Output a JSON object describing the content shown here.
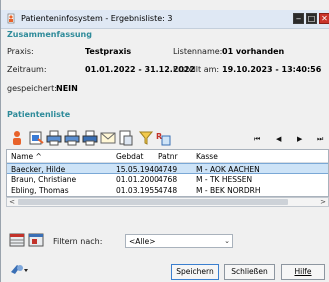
{
  "window": {
    "title": "Patienteninfosystem - Ergebnisliste: 3",
    "minimize": "‒",
    "maximize": "□",
    "close": "✕"
  },
  "summary": {
    "heading": "Zusammenfassung",
    "praxis_label": "Praxis:",
    "praxis_value": "Testpraxis",
    "listname_label": "Listenname:",
    "listname_value": "01 vorhanden",
    "zeitraum_label": "Zeitraum:",
    "zeitraum_value": "01.01.2022 - 31.12.2022",
    "erstellt_label": "Erstellt am:",
    "erstellt_value": "19.10.2023 - 13:40:56",
    "gespeichert_label": "gespeichert:",
    "gespeichert_value": "NEIN"
  },
  "patients": {
    "heading": "Patientenliste",
    "nav": {
      "first": "⏮",
      "prev": "◀",
      "next": "▶",
      "last": "⏭"
    },
    "columns": [
      "Name ^",
      "Gebdat",
      "Patnr",
      "Kasse"
    ],
    "rows": [
      {
        "name": "Baecker, Hilde",
        "gebdat": "15.05.1940",
        "patnr": "4749",
        "kasse": "M - AOK AACHEN"
      },
      {
        "name": "Braun, Christiane",
        "gebdat": "01.01.2000",
        "patnr": "4768",
        "kasse": "M - TK HESSEN"
      },
      {
        "name": "Ebling, Thomas",
        "gebdat": "01.03.1955",
        "patnr": "4748",
        "kasse": "M - BEK NORDRH"
      }
    ],
    "scroll_left": "<",
    "scroll_right": ">"
  },
  "filter": {
    "label": "Filtern nach:",
    "value": "<Alle>"
  },
  "buttons": {
    "save": "Speichern",
    "close": "Schließen",
    "help": "Hilfe"
  },
  "icons": {
    "app": "app-icon",
    "toolbar": [
      "people-icon",
      "export-icon",
      "print-icon",
      "print-preview-icon",
      "print-list-icon",
      "mail-icon",
      "document-icon",
      "filter-icon",
      "report-icon"
    ]
  }
}
